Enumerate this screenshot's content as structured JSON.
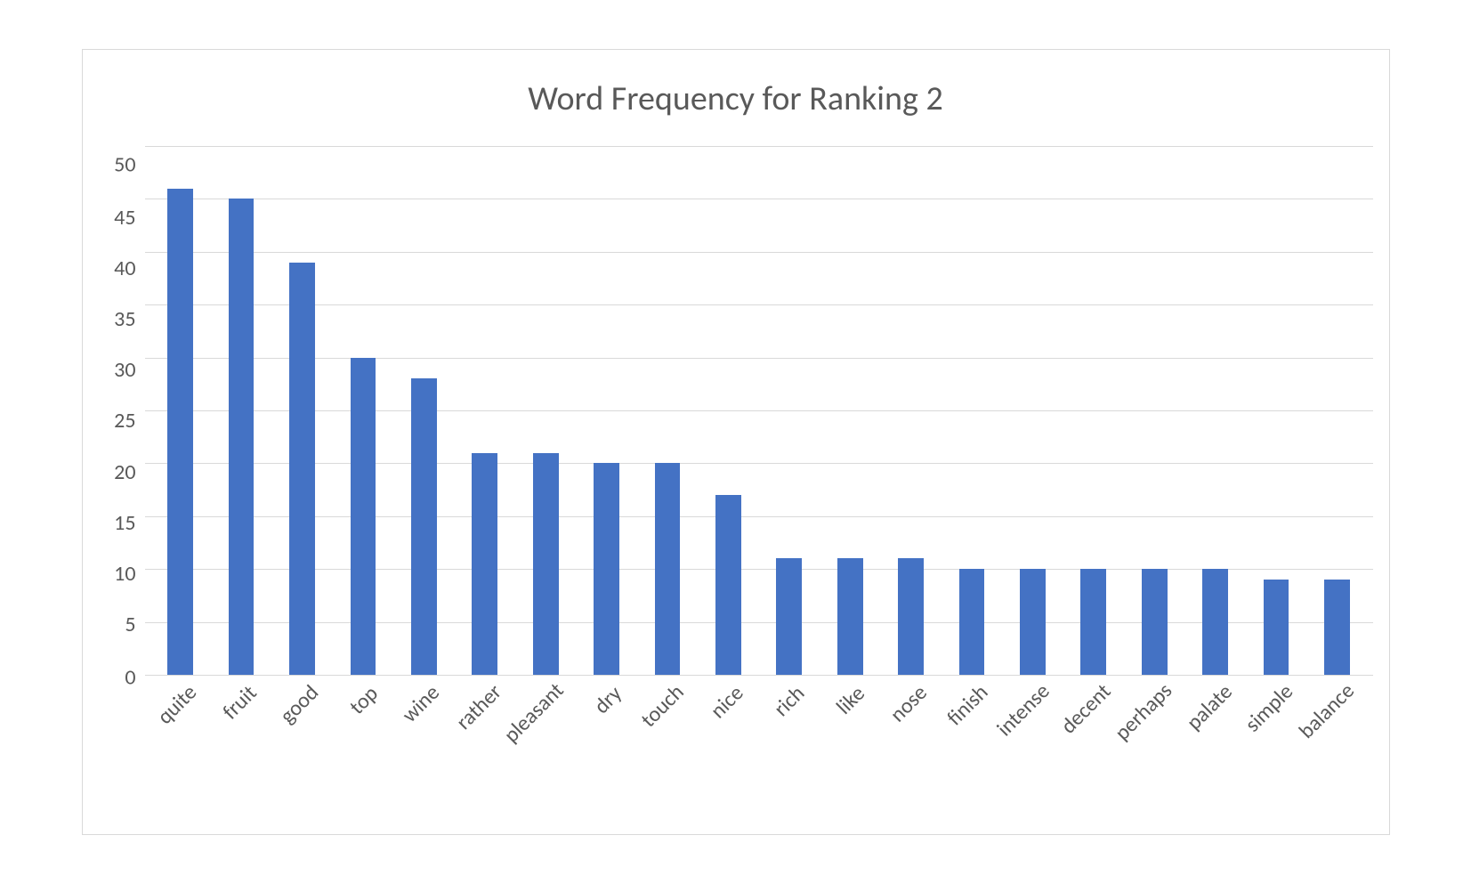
{
  "chart_data": {
    "type": "bar",
    "title": "Word Frequency for Ranking 2",
    "xlabel": "",
    "ylabel": "",
    "ylim": [
      0,
      50
    ],
    "yticks": [
      50,
      45,
      40,
      35,
      30,
      25,
      20,
      15,
      10,
      5,
      0
    ],
    "categories": [
      "quite",
      "fruit",
      "good",
      "top",
      "wine",
      "rather",
      "pleasant",
      "dry",
      "touch",
      "nice",
      "rich",
      "like",
      "nose",
      "finish",
      "intense",
      "decent",
      "perhaps",
      "palate",
      "simple",
      "balance"
    ],
    "values": [
      46,
      45,
      39,
      30,
      28,
      21,
      21,
      20,
      20,
      17,
      11,
      11,
      11,
      10,
      10,
      10,
      10,
      10,
      9,
      9
    ],
    "bar_color": "#4472C4",
    "grid": true
  }
}
